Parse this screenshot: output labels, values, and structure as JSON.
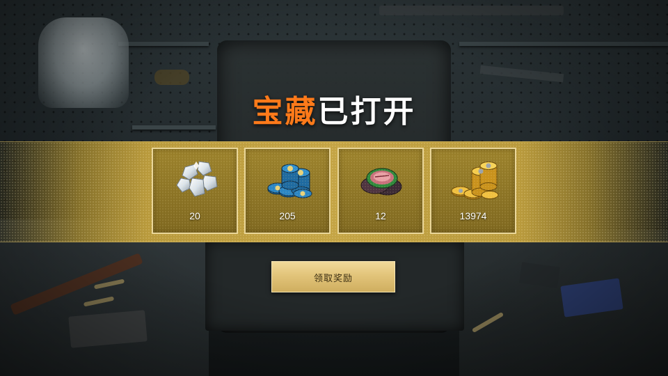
{
  "title": {
    "highlight": "宝藏",
    "rest": "已打开"
  },
  "rewards": [
    {
      "name": "diamonds",
      "icon": "diamond-icon",
      "quantity": "20"
    },
    {
      "name": "blue-coins",
      "icon": "blue-coin-stack-icon",
      "quantity": "205"
    },
    {
      "name": "green-token",
      "icon": "green-token-icon",
      "quantity": "12"
    },
    {
      "name": "gold-coins",
      "icon": "gold-coin-stack-icon",
      "quantity": "13974"
    }
  ],
  "claim_button": {
    "label": "领取奖励"
  },
  "colors": {
    "title_highlight": "#ff7a1a",
    "band_gold": "#c4a444",
    "button_gold": "#e2c47a"
  }
}
